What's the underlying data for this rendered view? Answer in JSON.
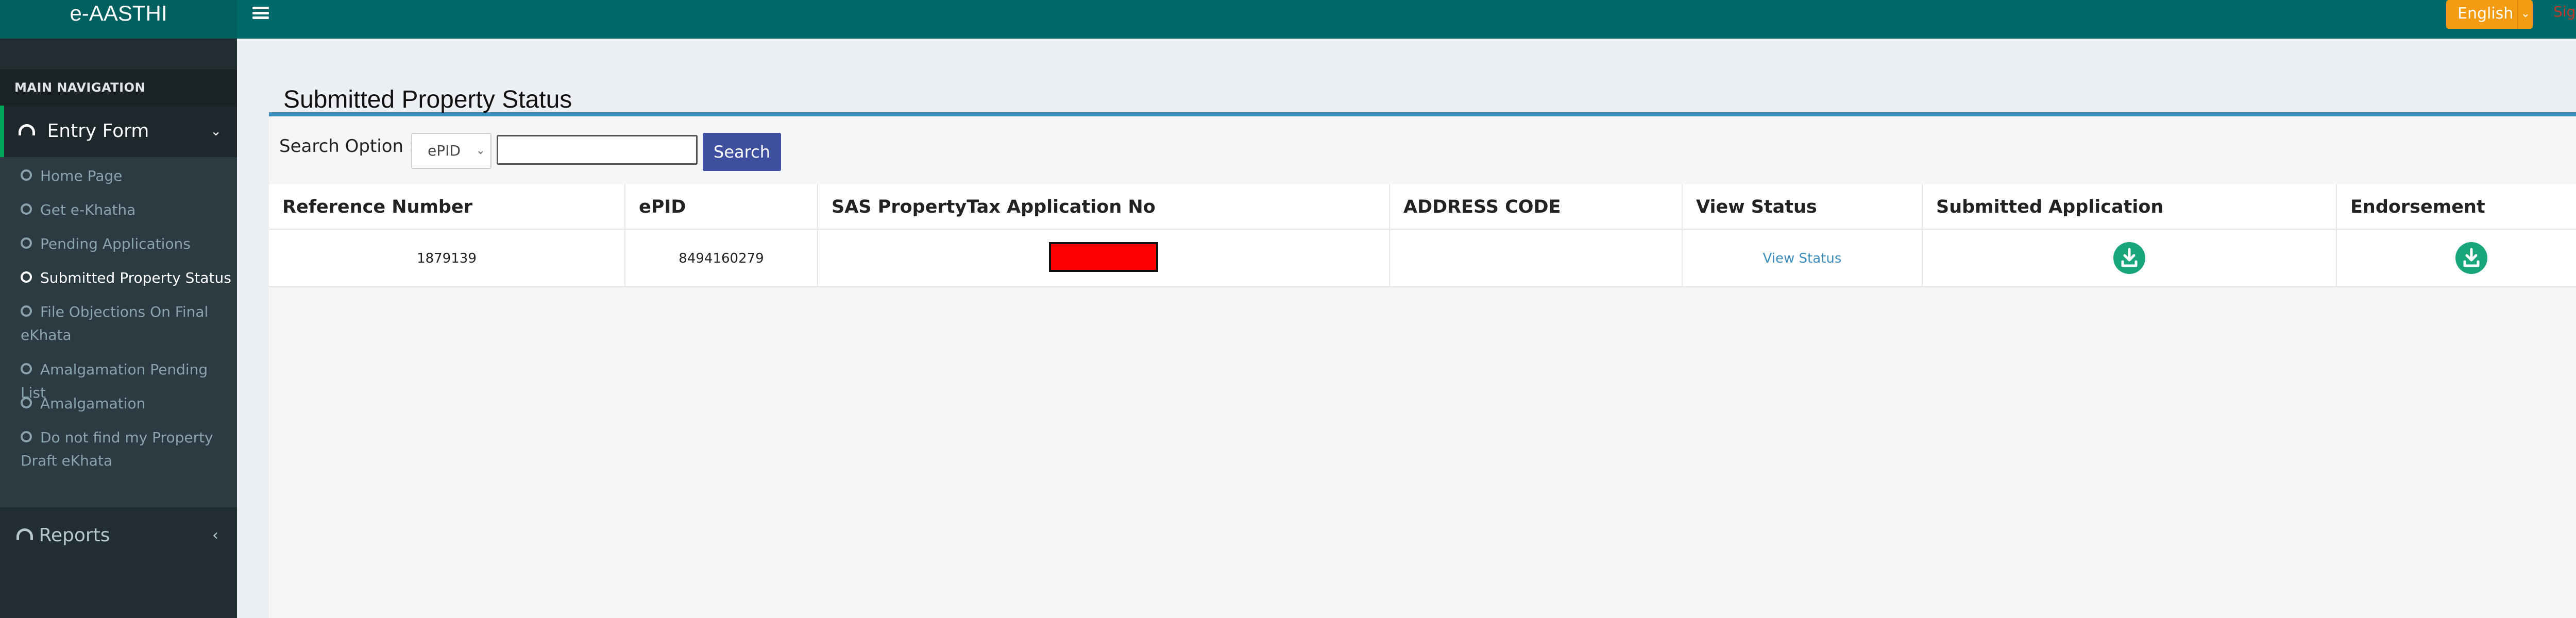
{
  "app": {
    "title": "e-AASTHI",
    "language": "English",
    "sign_out": "Sign out"
  },
  "sidebar": {
    "nav_header": "MAIN NAVIGATION",
    "entry_form": "Entry Form",
    "items": [
      {
        "label": "Home Page",
        "active": false
      },
      {
        "label": "Get e-Khatha",
        "active": false
      },
      {
        "label": "Pending Applications",
        "active": false
      },
      {
        "label": "Submitted Property Status",
        "active": true
      },
      {
        "label": "File Objections On Final",
        "label2": "eKhata",
        "active": false
      },
      {
        "label": "Amalgamation Pending List",
        "active": false
      },
      {
        "label": "Amalgamation",
        "active": false
      },
      {
        "label": "Do not find my Property",
        "label2": "Draft eKhata",
        "active": false
      }
    ],
    "reports": "Reports"
  },
  "main": {
    "title": "Submitted Property Status",
    "search": {
      "label": "Search Option :",
      "option": "ePID",
      "value": "",
      "button": "Search"
    },
    "table": {
      "headers": [
        "Reference Number",
        "ePID",
        "SAS PropertyTax Application No",
        "ADDRESS CODE",
        "View Status",
        "Submitted Application",
        "Endorsement"
      ],
      "rows": [
        {
          "reference": "1879139",
          "epid": "8494160279",
          "sas_no": "",
          "address_code": "",
          "view_status": "View Status"
        }
      ]
    }
  },
  "colors": {
    "header": "#006a6a",
    "sidebar": "#222d32",
    "accent": "#3c8dbc",
    "search_button": "#3f4fa0",
    "language": "#f39c12",
    "download": "#1aa67b"
  }
}
